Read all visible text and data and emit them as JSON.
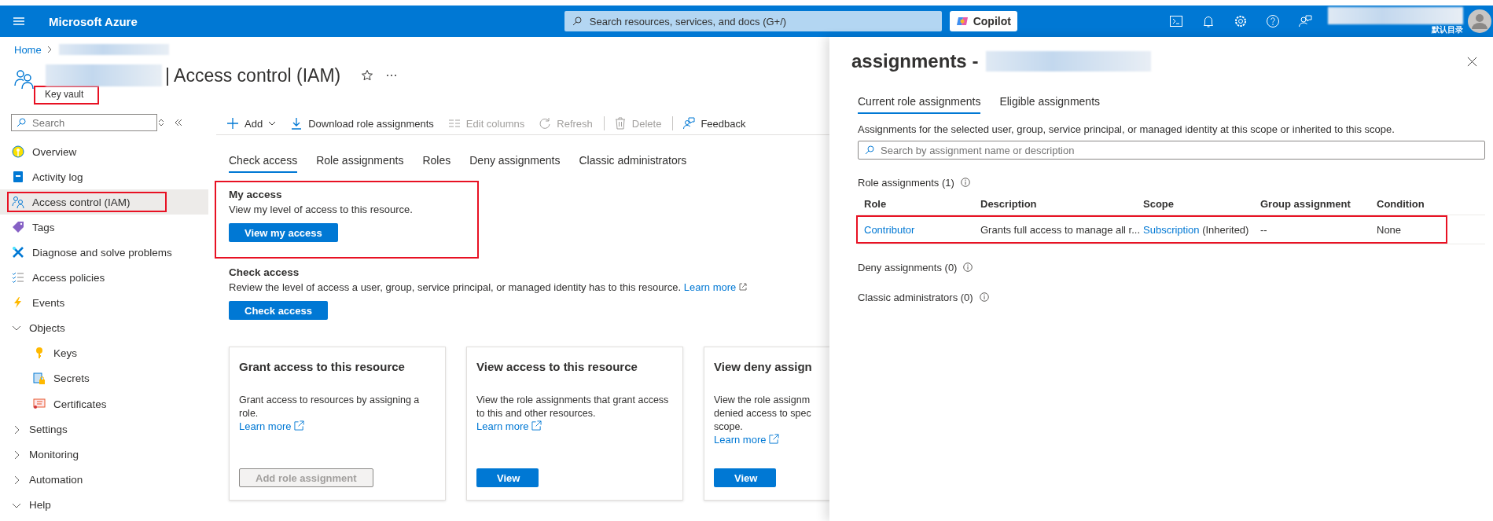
{
  "topbar": {
    "brand": "Microsoft Azure",
    "search": {
      "placeholder": "Search resources, services, and docs (G+/)"
    },
    "copilot": "Copilot",
    "directory": "默认目录"
  },
  "breadcrumb": {
    "home": "Home"
  },
  "header": {
    "title": "| Access control (IAM)",
    "subtitle": "Key vault",
    "subtitle_annotated": true
  },
  "sidebar": {
    "search": {
      "placeholder": "Search"
    },
    "items": [
      {
        "label": "Overview",
        "kind": "link",
        "selected": false,
        "annotated": false
      },
      {
        "label": "Activity log",
        "kind": "link",
        "selected": false,
        "annotated": false
      },
      {
        "label": "Access control (IAM)",
        "kind": "link",
        "selected": true,
        "annotated": true
      },
      {
        "label": "Tags",
        "kind": "link",
        "selected": false,
        "annotated": false
      },
      {
        "label": "Diagnose and solve problems",
        "kind": "link",
        "selected": false,
        "annotated": false
      },
      {
        "label": "Access policies",
        "kind": "link",
        "selected": false,
        "annotated": false
      },
      {
        "label": "Events",
        "kind": "link",
        "selected": false,
        "annotated": false
      },
      {
        "label": "Objects",
        "kind": "group",
        "expanded": true,
        "selected": false,
        "annotated": false,
        "children": [
          {
            "label": "Keys",
            "kind": "link",
            "selected": false,
            "annotated": false
          },
          {
            "label": "Secrets",
            "kind": "link",
            "selected": false,
            "annotated": false
          },
          {
            "label": "Certificates",
            "kind": "link",
            "selected": false,
            "annotated": false
          }
        ]
      },
      {
        "label": "Settings",
        "kind": "group",
        "expanded": false,
        "selected": false,
        "annotated": false
      },
      {
        "label": "Monitoring",
        "kind": "group",
        "expanded": false,
        "selected": false,
        "annotated": false
      },
      {
        "label": "Automation",
        "kind": "group",
        "expanded": false,
        "selected": false,
        "annotated": false
      },
      {
        "label": "Help",
        "kind": "group",
        "expanded": true,
        "selected": false,
        "annotated": false
      }
    ]
  },
  "toolbar": [
    {
      "label": "Add",
      "disabled": false,
      "dropdown": true
    },
    {
      "label": "Download role assignments",
      "disabled": false,
      "dropdown": false
    },
    {
      "label": "Edit columns",
      "disabled": true,
      "dropdown": false
    },
    {
      "label": "Refresh",
      "disabled": true,
      "dropdown": false
    },
    {
      "label": "Delete",
      "disabled": true,
      "dropdown": false
    },
    {
      "label": "Feedback",
      "disabled": false,
      "dropdown": false
    }
  ],
  "tabs": [
    {
      "label": "Check access",
      "selected": true
    },
    {
      "label": "Role assignments",
      "selected": false
    },
    {
      "label": "Roles",
      "selected": false
    },
    {
      "label": "Deny assignments",
      "selected": false
    },
    {
      "label": "Classic administrators",
      "selected": false
    }
  ],
  "my_access": {
    "heading": "My access",
    "text": "View my level of access to this resource.",
    "button": "View my access",
    "annotated": true
  },
  "check_access": {
    "heading": "Check access",
    "text": "Review the level of access a user, group, service principal, or managed identity has to this resource.",
    "link": "Learn more",
    "button": "Check access"
  },
  "cards": [
    {
      "title": "Grant access to this resource",
      "lines": [
        "Grant access to resources by assigning a",
        "role."
      ],
      "link": "Learn more",
      "button": {
        "label": "Add role assignment",
        "disabled": true
      }
    },
    {
      "title": "View access to this resource",
      "lines": [
        "View the role assignments that grant access",
        "to this and other resources."
      ],
      "link": "Learn more",
      "button": {
        "label": "View",
        "disabled": false
      }
    },
    {
      "title": "View deny assign",
      "lines": [
        "View the role assignm",
        "denied access to spec",
        "scope."
      ],
      "link": "Learn more",
      "button": {
        "label": "View",
        "disabled": false
      }
    }
  ],
  "panel": {
    "title": "assignments -",
    "tabs": [
      {
        "label": "Current role assignments",
        "selected": true
      },
      {
        "label": "Eligible assignments",
        "selected": false
      }
    ],
    "description": "Assignments for the selected user, group, service principal, or managed identity at this scope or inherited to this scope.",
    "search": {
      "placeholder": "Search by assignment name or description"
    },
    "role_section": "Role assignments (1)",
    "columns": [
      "Role",
      "Description",
      "Scope",
      "Group assignment",
      "Condition"
    ],
    "rows": [
      {
        "role": "Contributor",
        "description": "Grants full access to manage all r...",
        "scope": "Subscription",
        "scope_note": "(Inherited)",
        "group": "--",
        "condition": "None",
        "annotated": true
      }
    ],
    "deny_section": "Deny assignments (0)",
    "classic_section": "Classic administrators (0)"
  }
}
